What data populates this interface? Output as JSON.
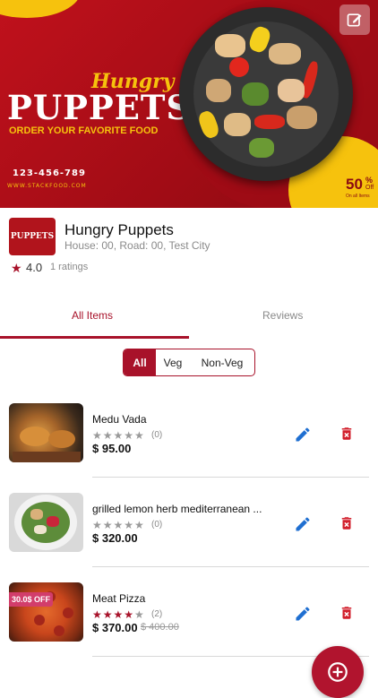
{
  "banner": {
    "script_title": "Hungry",
    "title": "PUPPETS",
    "subtitle": "ORDER YOUR FAVORITE FOOD",
    "phone": "123-456-789",
    "website": "WWW.STACKFOOD.COM",
    "discount_value": "50",
    "discount_unit": "%",
    "discount_off": "Off",
    "discount_note": "On all Items"
  },
  "restaurant": {
    "logo_text": "PUPPETS",
    "name": "Hungry Puppets",
    "address": "House: 00, Road: 00, Test City",
    "rating": "4.0",
    "rating_count": "1 ratings"
  },
  "tabs": {
    "all_items": "All Items",
    "reviews": "Reviews"
  },
  "filter": {
    "all": "All",
    "veg": "Veg",
    "non_veg": "Non-Veg"
  },
  "items": [
    {
      "name": "Medu Vada",
      "stars": "★★★★★",
      "count": "(0)",
      "price": "$ 95.00",
      "old_price": "",
      "badge": ""
    },
    {
      "name": "grilled lemon herb mediterranean ...",
      "stars": "★★★★★",
      "count": "(0)",
      "price": "$ 320.00",
      "old_price": "",
      "badge": ""
    },
    {
      "name": "Meat Pizza",
      "stars": "★★★★★",
      "count": "(2)",
      "price": "$ 370.00",
      "old_price": "$ 400.00",
      "badge": "30.0$ OFF"
    }
  ],
  "colors": {
    "primary": "#a8122a",
    "edit_icon": "#1f6fd1",
    "delete_icon": "#d21f2b"
  }
}
